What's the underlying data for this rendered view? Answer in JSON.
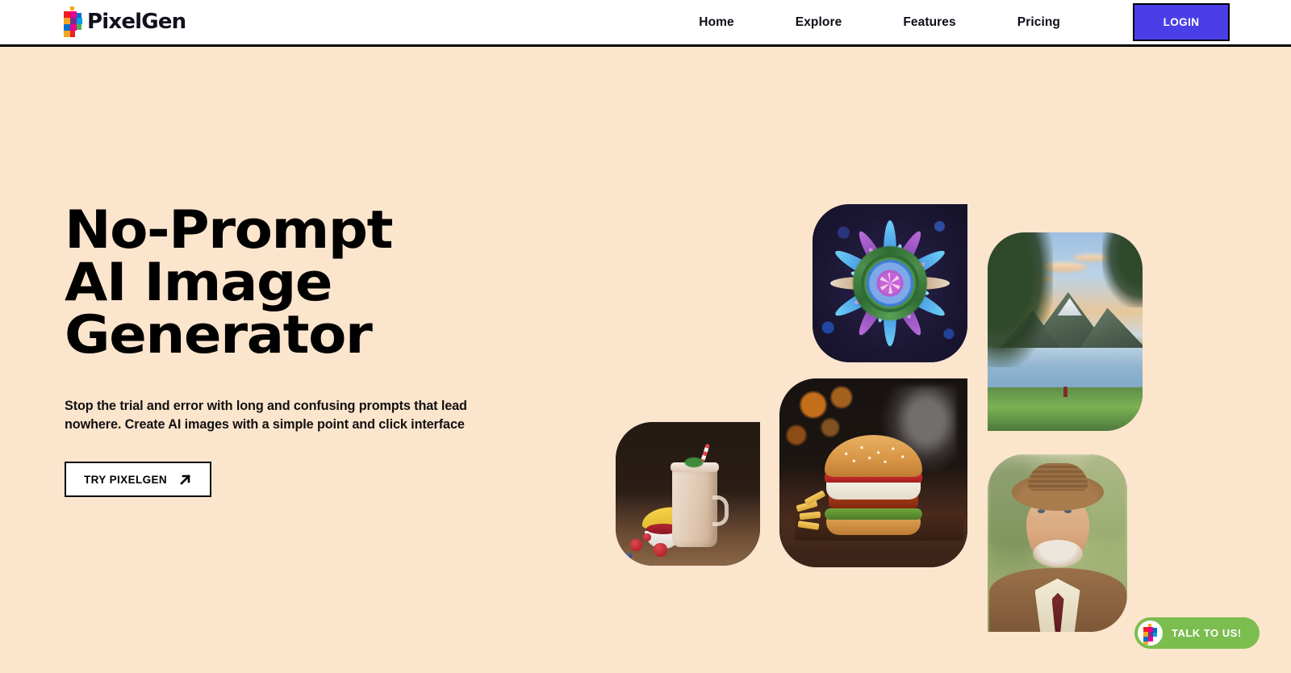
{
  "brand": {
    "name": "PixelGen",
    "logo_icon": "pixel-p-logo-icon",
    "logo_colors": {
      "yellow": "#f5a623",
      "magenta": "#ec008c",
      "red": "#ed1c24",
      "blue": "#0071ce",
      "cyan": "#00a0e3",
      "green": "#4caf50",
      "purple": "#7b2d8e"
    }
  },
  "nav": {
    "items": [
      {
        "label": "Home",
        "name": "nav-home"
      },
      {
        "label": "Explore",
        "name": "nav-explore"
      },
      {
        "label": "Features",
        "name": "nav-features"
      },
      {
        "label": "Pricing",
        "name": "nav-pricing"
      }
    ],
    "login_label": "LOGIN",
    "login_bg": "#4a3fe6"
  },
  "hero": {
    "headline": "No-Prompt\nAI Image Generator",
    "subcopy": "Stop the trial and error with long and confusing prompts that lead nowhere. Create AI images with a simple point and click interface",
    "cta_label": "TRY PIXELGEN",
    "cta_icon": "arrow-up-right-icon",
    "background": "#fce5cd"
  },
  "gallery": {
    "items": [
      {
        "name": "gallery-image-mandala",
        "alt": "Colorful blue and purple mandala artwork on dark background"
      },
      {
        "name": "gallery-image-landscape",
        "alt": "Mountain lake landscape at sunrise with a hiker"
      },
      {
        "name": "gallery-image-smoothie",
        "alt": "Banana strawberry smoothie in a mason jar with berries"
      },
      {
        "name": "gallery-image-burger",
        "alt": "Crispy chicken burger with fries and smoke"
      },
      {
        "name": "gallery-image-portrait",
        "alt": "Smiling elderly man wearing a straw hat and brown suit"
      }
    ]
  },
  "chat": {
    "label": "TALK TO US!",
    "avatar_icon": "pixelgen-avatar-icon",
    "bg": "#7cbd4f"
  }
}
